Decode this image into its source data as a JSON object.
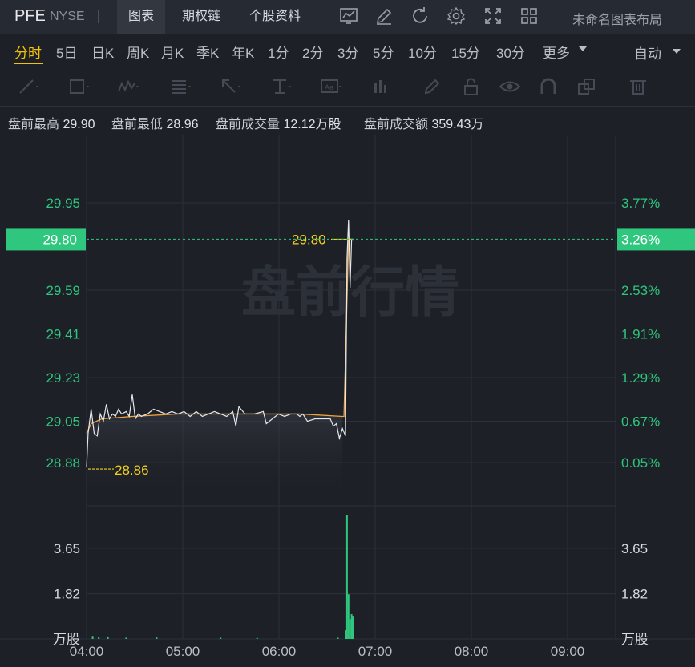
{
  "header": {
    "ticker": "PFE",
    "exchange": "NYSE",
    "tabs": [
      "图表",
      "期权链",
      "个股资料"
    ],
    "active_tab": 0,
    "layout_label": "未命名图表布局",
    "icons": [
      "line-chart-icon",
      "edit-icon",
      "refresh-icon",
      "settings-icon",
      "fullscreen-icon",
      "grid-layout-icon"
    ]
  },
  "periods": {
    "items": [
      "分时",
      "5日",
      "日K",
      "周K",
      "月K",
      "季K",
      "年K",
      "1分",
      "2分",
      "3分",
      "5分",
      "10分",
      "15分",
      "30分",
      "更多"
    ],
    "active": 0,
    "auto_label": "自动"
  },
  "draw_tools": [
    "trend-line-icon",
    "rectangle-icon",
    "wave-icon",
    "fibonacci-icon",
    "arrow-icon",
    "measure-icon",
    "text-icon",
    "bar-tool-icon",
    "pen-icon",
    "lock-icon",
    "eye-icon",
    "magnet-icon",
    "layers-icon",
    "delete-icon"
  ],
  "info": {
    "high_label": "盘前最高",
    "high_value": "29.90",
    "low_label": "盘前最低",
    "low_value": "28.96",
    "vol_label": "盘前成交量",
    "vol_value": "12.12万股",
    "amt_label": "盘前成交额",
    "amt_value": "359.43万"
  },
  "colors": {
    "price_line": "#e6e8ec",
    "avg_line": "#f0a43a",
    "up_green": "#2fc67d",
    "highlight": "#f3d21b",
    "current_tag": "#2fc67d"
  },
  "chart_data": {
    "type": "line",
    "watermark": "盘前行情",
    "price_ticks": [
      29.95,
      29.59,
      29.41,
      29.23,
      29.05,
      28.88
    ],
    "pct_ticks": [
      "3.77%",
      "2.53%",
      "1.91%",
      "1.29%",
      "0.67%",
      "0.05%"
    ],
    "current_price": "29.80",
    "current_pct": "3.26%",
    "high_label": "29.80",
    "low_label": "28.86",
    "time_ticks": [
      "04:00",
      "05:00",
      "06:00",
      "07:00",
      "08:00",
      "09:00"
    ],
    "ylim": [
      28.78,
      30.08
    ],
    "price_series": {
      "name": "price",
      "points": [
        [
          0,
          28.86
        ],
        [
          1,
          29.0
        ],
        [
          3,
          29.1
        ],
        [
          5,
          29.0
        ],
        [
          7,
          28.99
        ],
        [
          9,
          29.08
        ],
        [
          11,
          29.05
        ],
        [
          13,
          29.12
        ],
        [
          15,
          29.06
        ],
        [
          17,
          29.08
        ],
        [
          19,
          29.07
        ],
        [
          21,
          29.1
        ],
        [
          23,
          29.08
        ],
        [
          26,
          29.09
        ],
        [
          28,
          29.07
        ],
        [
          30,
          29.16
        ],
        [
          32,
          29.06
        ],
        [
          34,
          29.08
        ],
        [
          36,
          29.07
        ],
        [
          40,
          29.08
        ],
        [
          44,
          29.1
        ],
        [
          48,
          29.09
        ],
        [
          52,
          29.08
        ],
        [
          56,
          29.09
        ],
        [
          60,
          29.08
        ],
        [
          64,
          29.09
        ],
        [
          68,
          29.07
        ],
        [
          72,
          29.09
        ],
        [
          76,
          29.07
        ],
        [
          80,
          29.08
        ],
        [
          84,
          29.09
        ],
        [
          88,
          29.08
        ],
        [
          92,
          29.07
        ],
        [
          96,
          29.09
        ],
        [
          98,
          29.03
        ],
        [
          100,
          29.11
        ],
        [
          104,
          29.08
        ],
        [
          110,
          29.08
        ],
        [
          116,
          29.09
        ],
        [
          118,
          29.04
        ],
        [
          122,
          29.06
        ],
        [
          126,
          29.08
        ],
        [
          130,
          29.07
        ],
        [
          134,
          29.08
        ],
        [
          138,
          29.08
        ],
        [
          140,
          29.07
        ],
        [
          142,
          29.08
        ],
        [
          145,
          29.05
        ],
        [
          150,
          29.06
        ],
        [
          154,
          29.06
        ],
        [
          160,
          29.06
        ],
        [
          162,
          29.03
        ],
        [
          164,
          29.04
        ],
        [
          166,
          28.98
        ],
        [
          168,
          29.02
        ],
        [
          170,
          28.99
        ],
        [
          171,
          29.72
        ],
        [
          172,
          29.88
        ],
        [
          173,
          29.6
        ],
        [
          174,
          29.8
        ],
        [
          175,
          29.8
        ]
      ]
    },
    "avg_series": {
      "name": "avg",
      "points": [
        [
          0,
          29.0
        ],
        [
          3,
          29.04
        ],
        [
          10,
          29.06
        ],
        [
          30,
          29.07
        ],
        [
          60,
          29.08
        ],
        [
          100,
          29.08
        ],
        [
          140,
          29.08
        ],
        [
          168,
          29.07
        ],
        [
          169,
          29.07
        ],
        [
          172,
          29.8
        ],
        [
          175,
          29.8
        ]
      ]
    },
    "volume": {
      "ticks": [
        3.65,
        1.82
      ],
      "unit": "万股",
      "ylim": [
        0,
        5.0
      ],
      "bars": [
        [
          4,
          0.12
        ],
        [
          8,
          0.08
        ],
        [
          14,
          0.1
        ],
        [
          26,
          0.05
        ],
        [
          46,
          0.06
        ],
        [
          88,
          0.05
        ],
        [
          112,
          0.04
        ],
        [
          165,
          0.05
        ],
        [
          170,
          0.35
        ],
        [
          171,
          5.0
        ],
        [
          172,
          1.8
        ],
        [
          173,
          0.8
        ],
        [
          174,
          1.0
        ],
        [
          175,
          0.9
        ]
      ]
    }
  }
}
